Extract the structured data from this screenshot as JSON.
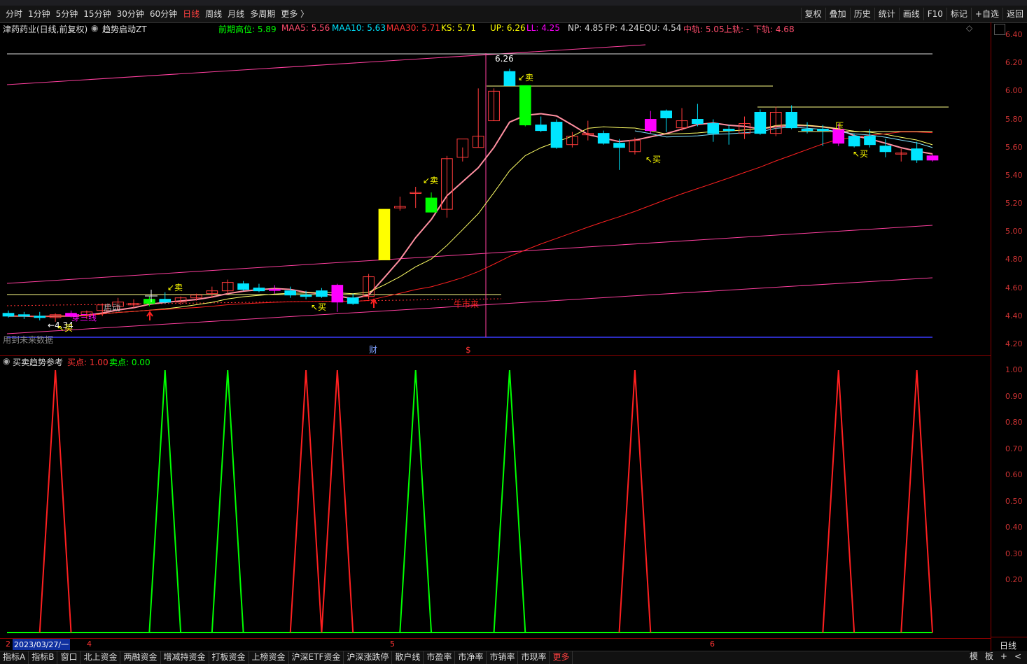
{
  "toolbar": {
    "periods": [
      "分时",
      "1分钟",
      "5分钟",
      "15分钟",
      "30分钟",
      "60分钟",
      "日线",
      "周线",
      "月线",
      "多周期",
      "更多 〉"
    ],
    "active_period": "日线",
    "actions": [
      "复权",
      "叠加",
      "历史",
      "统计",
      "画线",
      "F10",
      "标记",
      "+自选",
      "返回"
    ]
  },
  "chart_header": {
    "stock": "津药药业(日线,前复权)",
    "indicator": "趋势启动ZT",
    "prev_high": "前期高位: 5.89",
    "maa5": "MAA5: 5.56",
    "maa10": "MAA10: 5.63",
    "maa30": "MAA30: 5.71",
    "ks": "KS: 5.71",
    "up": "UP: 6.26",
    "ll": "LL: 4.25",
    "np": "NP: 4.85",
    "fp": "FP: 4.24",
    "equ": "EQU: 4.54",
    "mid": "中轨: 5.05",
    "upper": "上轨: -",
    "lower": "下轨: 4.68"
  },
  "price_axis": [
    "6.40",
    "6.20",
    "6.00",
    "5.80",
    "5.60",
    "5.40",
    "5.20",
    "5.00",
    "4.80",
    "4.60",
    "4.40",
    "4.20"
  ],
  "sub_axis": [
    "1.00",
    "0.90",
    "0.80",
    "0.70",
    "0.60",
    "0.50",
    "0.40",
    "0.30",
    "0.20"
  ],
  "annotations": {
    "high_label": "6.26",
    "low_label": "4.34",
    "sell": "卖",
    "buy": "买",
    "pressure": "压",
    "bull": "牛市来",
    "third_line": "穿三线",
    "start": "启动",
    "future_data": "用到未来数据",
    "fin": "财",
    "dollar": "$"
  },
  "sub_header": {
    "name": "买卖趋势参考",
    "buy": "买点: 1.00",
    "sell": "卖点: 0.00"
  },
  "date_row": {
    "cursor_date": "2023/03/27/一",
    "m4": "4",
    "m5": "5",
    "m6": "6",
    "period": "日线"
  },
  "bottom_tabs": [
    "指标A",
    "指标B",
    "窗口",
    "北上资金",
    "两融资金",
    "增减持资金",
    "打板资金",
    "上榜资金",
    "沪深ETF资金",
    "沪深涨跌停",
    "散户线",
    "市盈率",
    "市净率",
    "市销率",
    "市现率",
    "更多"
  ],
  "bottom_right": [
    "模",
    "板",
    "+",
    "<"
  ],
  "colors": {
    "up": "#ff3b3b",
    "down": "#00e5ff",
    "magenta": "#ff00ff",
    "green": "#00ff00",
    "yellow": "#ffff00"
  },
  "chart_data": {
    "type": "candlestick",
    "ylim": [
      4.2,
      6.4
    ],
    "candles": [
      {
        "o": 4.42,
        "h": 4.44,
        "l": 4.39,
        "c": 4.4
      },
      {
        "o": 4.41,
        "h": 4.43,
        "l": 4.38,
        "c": 4.4
      },
      {
        "o": 4.4,
        "h": 4.43,
        "l": 4.37,
        "c": 4.39
      },
      {
        "o": 4.39,
        "h": 4.42,
        "l": 4.36,
        "c": 4.41
      },
      {
        "o": 4.42,
        "h": 4.44,
        "l": 4.39,
        "c": 4.4
      },
      {
        "o": 4.41,
        "h": 4.44,
        "l": 4.38,
        "c": 4.43
      },
      {
        "o": 4.44,
        "h": 4.49,
        "l": 4.4,
        "c": 4.48
      },
      {
        "o": 4.47,
        "h": 4.53,
        "l": 4.45,
        "c": 4.5
      },
      {
        "o": 4.48,
        "h": 4.52,
        "l": 4.46,
        "c": 4.49
      },
      {
        "o": 4.49,
        "h": 4.54,
        "l": 4.47,
        "c": 4.52
      },
      {
        "o": 4.52,
        "h": 4.57,
        "l": 4.49,
        "c": 4.5
      },
      {
        "o": 4.5,
        "h": 4.54,
        "l": 4.48,
        "c": 4.53
      },
      {
        "o": 4.53,
        "h": 4.56,
        "l": 4.51,
        "c": 4.55
      },
      {
        "o": 4.56,
        "h": 4.61,
        "l": 4.53,
        "c": 4.58
      },
      {
        "o": 4.58,
        "h": 4.66,
        "l": 4.56,
        "c": 4.64
      },
      {
        "o": 4.63,
        "h": 4.65,
        "l": 4.58,
        "c": 4.59
      },
      {
        "o": 4.6,
        "h": 4.63,
        "l": 4.57,
        "c": 4.58
      },
      {
        "o": 4.59,
        "h": 4.62,
        "l": 4.56,
        "c": 4.59
      },
      {
        "o": 4.58,
        "h": 4.61,
        "l": 4.53,
        "c": 4.55
      },
      {
        "o": 4.55,
        "h": 4.58,
        "l": 4.52,
        "c": 4.54
      },
      {
        "o": 4.58,
        "h": 4.6,
        "l": 4.53,
        "c": 4.54
      },
      {
        "o": 4.62,
        "h": 4.63,
        "l": 4.43,
        "c": 4.5
      },
      {
        "o": 4.53,
        "h": 4.56,
        "l": 4.48,
        "c": 4.49
      },
      {
        "o": 4.54,
        "h": 4.7,
        "l": 4.52,
        "c": 4.68
      },
      {
        "o": 4.8,
        "h": 5.16,
        "l": 4.8,
        "c": 5.16
      },
      {
        "o": 5.17,
        "h": 5.25,
        "l": 5.15,
        "c": 5.18
      },
      {
        "o": 5.28,
        "h": 5.32,
        "l": 5.17,
        "c": 5.28
      },
      {
        "o": 5.24,
        "h": 5.28,
        "l": 5.14,
        "c": 5.14
      },
      {
        "o": 5.16,
        "h": 5.54,
        "l": 5.1,
        "c": 5.52
      },
      {
        "o": 5.53,
        "h": 5.6,
        "l": 5.5,
        "c": 5.66
      },
      {
        "o": 5.6,
        "h": 6.02,
        "l": 5.6,
        "c": 5.68
      },
      {
        "o": 5.79,
        "h": 6.02,
        "l": 5.79,
        "c": 6.0
      },
      {
        "o": 6.14,
        "h": 6.16,
        "l": 6.04,
        "c": 6.04
      },
      {
        "o": 6.04,
        "h": 6.04,
        "l": 5.75,
        "c": 5.76
      },
      {
        "o": 5.76,
        "h": 5.82,
        "l": 5.71,
        "c": 5.72
      },
      {
        "o": 5.78,
        "h": 5.8,
        "l": 5.59,
        "c": 5.6
      },
      {
        "o": 5.62,
        "h": 5.71,
        "l": 5.6,
        "c": 5.68
      },
      {
        "o": 5.69,
        "h": 5.79,
        "l": 5.65,
        "c": 5.7
      },
      {
        "o": 5.7,
        "h": 5.72,
        "l": 5.62,
        "c": 5.63
      },
      {
        "o": 5.63,
        "h": 5.66,
        "l": 5.44,
        "c": 5.6
      },
      {
        "o": 5.57,
        "h": 5.67,
        "l": 5.55,
        "c": 5.65
      },
      {
        "o": 5.72,
        "h": 5.86,
        "l": 5.7,
        "c": 5.8
      },
      {
        "o": 5.86,
        "h": 5.87,
        "l": 5.71,
        "c": 5.81
      },
      {
        "o": 5.74,
        "h": 5.88,
        "l": 5.72,
        "c": 5.79
      },
      {
        "o": 5.8,
        "h": 5.91,
        "l": 5.75,
        "c": 5.77
      },
      {
        "o": 5.77,
        "h": 5.8,
        "l": 5.64,
        "c": 5.7
      },
      {
        "o": 5.73,
        "h": 5.76,
        "l": 5.62,
        "c": 5.72
      },
      {
        "o": 5.7,
        "h": 5.82,
        "l": 5.66,
        "c": 5.77
      },
      {
        "o": 5.85,
        "h": 5.87,
        "l": 5.69,
        "c": 5.7
      },
      {
        "o": 5.7,
        "h": 5.89,
        "l": 5.68,
        "c": 5.85
      },
      {
        "o": 5.85,
        "h": 5.9,
        "l": 5.73,
        "c": 5.74
      },
      {
        "o": 5.73,
        "h": 5.78,
        "l": 5.7,
        "c": 5.72
      },
      {
        "o": 5.73,
        "h": 5.76,
        "l": 5.61,
        "c": 5.72
      },
      {
        "o": 5.73,
        "h": 5.77,
        "l": 5.61,
        "c": 5.63
      },
      {
        "o": 5.68,
        "h": 5.7,
        "l": 5.6,
        "c": 5.61
      },
      {
        "o": 5.68,
        "h": 5.73,
        "l": 5.6,
        "c": 5.62
      },
      {
        "o": 5.61,
        "h": 5.66,
        "l": 5.53,
        "c": 5.57
      },
      {
        "o": 5.56,
        "h": 5.59,
        "l": 5.5,
        "c": 5.56
      },
      {
        "o": 5.59,
        "h": 5.64,
        "l": 5.49,
        "c": 5.51
      },
      {
        "o": 5.54,
        "h": 5.55,
        "l": 5.5,
        "c": 5.51
      }
    ],
    "special": {
      "magenta": [
        4,
        17,
        21,
        41,
        53,
        59
      ],
      "yellow": [
        24
      ],
      "green": [
        9,
        27,
        33
      ],
      "white_cross": [
        8
      ]
    },
    "signal": [
      0,
      0,
      0,
      1,
      0,
      0,
      0,
      0,
      0,
      0,
      0,
      0,
      0,
      0,
      0,
      0,
      0,
      0,
      0,
      0,
      0,
      0,
      0,
      0,
      0,
      0,
      0,
      0,
      0,
      0,
      0,
      0,
      0,
      0,
      0,
      0,
      0,
      0,
      0,
      0,
      0,
      0,
      0,
      0,
      0,
      0,
      0,
      0,
      0,
      0,
      0,
      0,
      0,
      0,
      0,
      0,
      0,
      0,
      0,
      1
    ],
    "signal_peaks": [
      {
        "i": 3,
        "c": "r"
      },
      {
        "i": 10,
        "c": "g"
      },
      {
        "i": 14,
        "c": "g"
      },
      {
        "i": 19,
        "c": "r"
      },
      {
        "i": 21,
        "c": "r"
      },
      {
        "i": 26,
        "c": "g"
      },
      {
        "i": 32,
        "c": "g"
      },
      {
        "i": 40,
        "c": "r"
      },
      {
        "i": 53,
        "c": "r"
      },
      {
        "i": 58,
        "c": "r"
      }
    ]
  }
}
